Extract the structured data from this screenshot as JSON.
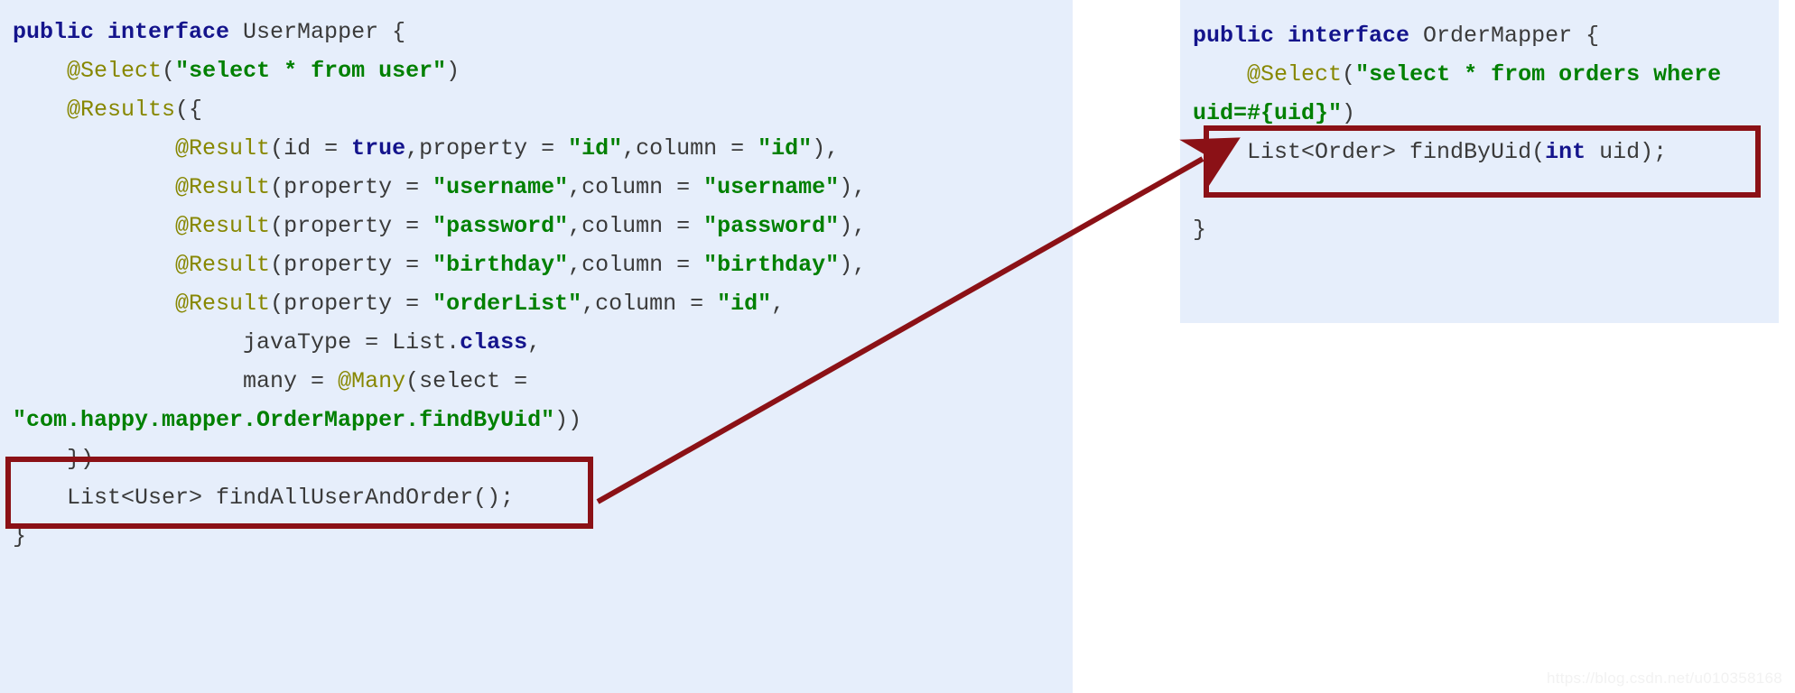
{
  "colors": {
    "panel_background": "#e6eefb",
    "page_background": "#ffffff",
    "keyword": "#14148c",
    "annotation": "#878700",
    "string": "#008000",
    "plain": "#3a3a3a",
    "highlight_border": "#8b1116",
    "arrow": "#8b1116",
    "watermark": "#f2f2f2"
  },
  "left_panel": {
    "name": "UserMapper",
    "lines": [
      [
        {
          "t": "public interface ",
          "c": "kw"
        },
        {
          "t": "UserMapper {",
          "c": "pln"
        }
      ],
      [
        {
          "t": "    ",
          "c": "pln"
        },
        {
          "t": "@Select",
          "c": "ann"
        },
        {
          "t": "(",
          "c": "pln"
        },
        {
          "t": "\"select * from user\"",
          "c": "str"
        },
        {
          "t": ")",
          "c": "pln"
        }
      ],
      [
        {
          "t": "    ",
          "c": "pln"
        },
        {
          "t": "@Results",
          "c": "ann"
        },
        {
          "t": "({",
          "c": "pln"
        }
      ],
      [
        {
          "t": "            ",
          "c": "pln"
        },
        {
          "t": "@Result",
          "c": "ann"
        },
        {
          "t": "(id = ",
          "c": "pln"
        },
        {
          "t": "true",
          "c": "kw"
        },
        {
          "t": ",property = ",
          "c": "pln"
        },
        {
          "t": "\"id\"",
          "c": "str"
        },
        {
          "t": ",column = ",
          "c": "pln"
        },
        {
          "t": "\"id\"",
          "c": "str"
        },
        {
          "t": "),",
          "c": "pln"
        }
      ],
      [
        {
          "t": "            ",
          "c": "pln"
        },
        {
          "t": "@Result",
          "c": "ann"
        },
        {
          "t": "(property = ",
          "c": "pln"
        },
        {
          "t": "\"username\"",
          "c": "str"
        },
        {
          "t": ",column = ",
          "c": "pln"
        },
        {
          "t": "\"username\"",
          "c": "str"
        },
        {
          "t": "),",
          "c": "pln"
        }
      ],
      [
        {
          "t": "            ",
          "c": "pln"
        },
        {
          "t": "@Result",
          "c": "ann"
        },
        {
          "t": "(property = ",
          "c": "pln"
        },
        {
          "t": "\"password\"",
          "c": "str"
        },
        {
          "t": ",column = ",
          "c": "pln"
        },
        {
          "t": "\"password\"",
          "c": "str"
        },
        {
          "t": "),",
          "c": "pln"
        }
      ],
      [
        {
          "t": "            ",
          "c": "pln"
        },
        {
          "t": "@Result",
          "c": "ann"
        },
        {
          "t": "(property = ",
          "c": "pln"
        },
        {
          "t": "\"birthday\"",
          "c": "str"
        },
        {
          "t": ",column = ",
          "c": "pln"
        },
        {
          "t": "\"birthday\"",
          "c": "str"
        },
        {
          "t": "),",
          "c": "pln"
        }
      ],
      [
        {
          "t": "            ",
          "c": "pln"
        },
        {
          "t": "@Result",
          "c": "ann"
        },
        {
          "t": "(property = ",
          "c": "pln"
        },
        {
          "t": "\"orderList\"",
          "c": "str"
        },
        {
          "t": ",column = ",
          "c": "pln"
        },
        {
          "t": "\"id\"",
          "c": "str"
        },
        {
          "t": ",",
          "c": "pln"
        }
      ],
      [
        {
          "t": "                 javaType = List.",
          "c": "pln"
        },
        {
          "t": "class",
          "c": "kw"
        },
        {
          "t": ",",
          "c": "pln"
        }
      ],
      [
        {
          "t": "                 many = ",
          "c": "pln"
        },
        {
          "t": "@Many",
          "c": "ann"
        },
        {
          "t": "(select = ",
          "c": "pln"
        }
      ],
      [
        {
          "t": "\"com.happy.mapper.OrderMapper.findByUid\"",
          "c": "str"
        },
        {
          "t": "))",
          "c": "pln"
        }
      ],
      [
        {
          "t": "    })",
          "c": "pln"
        }
      ],
      [
        {
          "t": "    List<User> findAllUserAndOrder();",
          "c": "pln"
        }
      ],
      [
        {
          "t": "}",
          "c": "pln"
        }
      ]
    ]
  },
  "right_panel": {
    "name": "OrderMapper",
    "lines": [
      [
        {
          "t": "public interface ",
          "c": "kw"
        },
        {
          "t": "OrderMapper {",
          "c": "pln"
        }
      ],
      [
        {
          "t": "    ",
          "c": "pln"
        },
        {
          "t": "@Select",
          "c": "ann"
        },
        {
          "t": "(",
          "c": "pln"
        },
        {
          "t": "\"select * from orders where uid=#{uid}\"",
          "c": "str"
        },
        {
          "t": ")",
          "c": "pln"
        }
      ],
      [
        {
          "t": "    List<Order> findByUid(",
          "c": "pln"
        },
        {
          "t": "int",
          "c": "kw"
        },
        {
          "t": " uid);",
          "c": "pln"
        }
      ],
      [
        {
          "t": "",
          "c": "pln"
        }
      ],
      [
        {
          "t": "}",
          "c": "pln"
        }
      ]
    ]
  },
  "highlights": {
    "left_box_label": "many = @Many(select = \"com.happy.mapper.OrderMapper.findByUid\"))",
    "right_box_label": "List<Order> findByUid(int uid);"
  },
  "arrow": {
    "label": "reference-arrow",
    "from": "left-highlight-box",
    "to": "right-highlight-box"
  },
  "watermark": {
    "text": "https://blog.csdn.net/u010358168"
  }
}
